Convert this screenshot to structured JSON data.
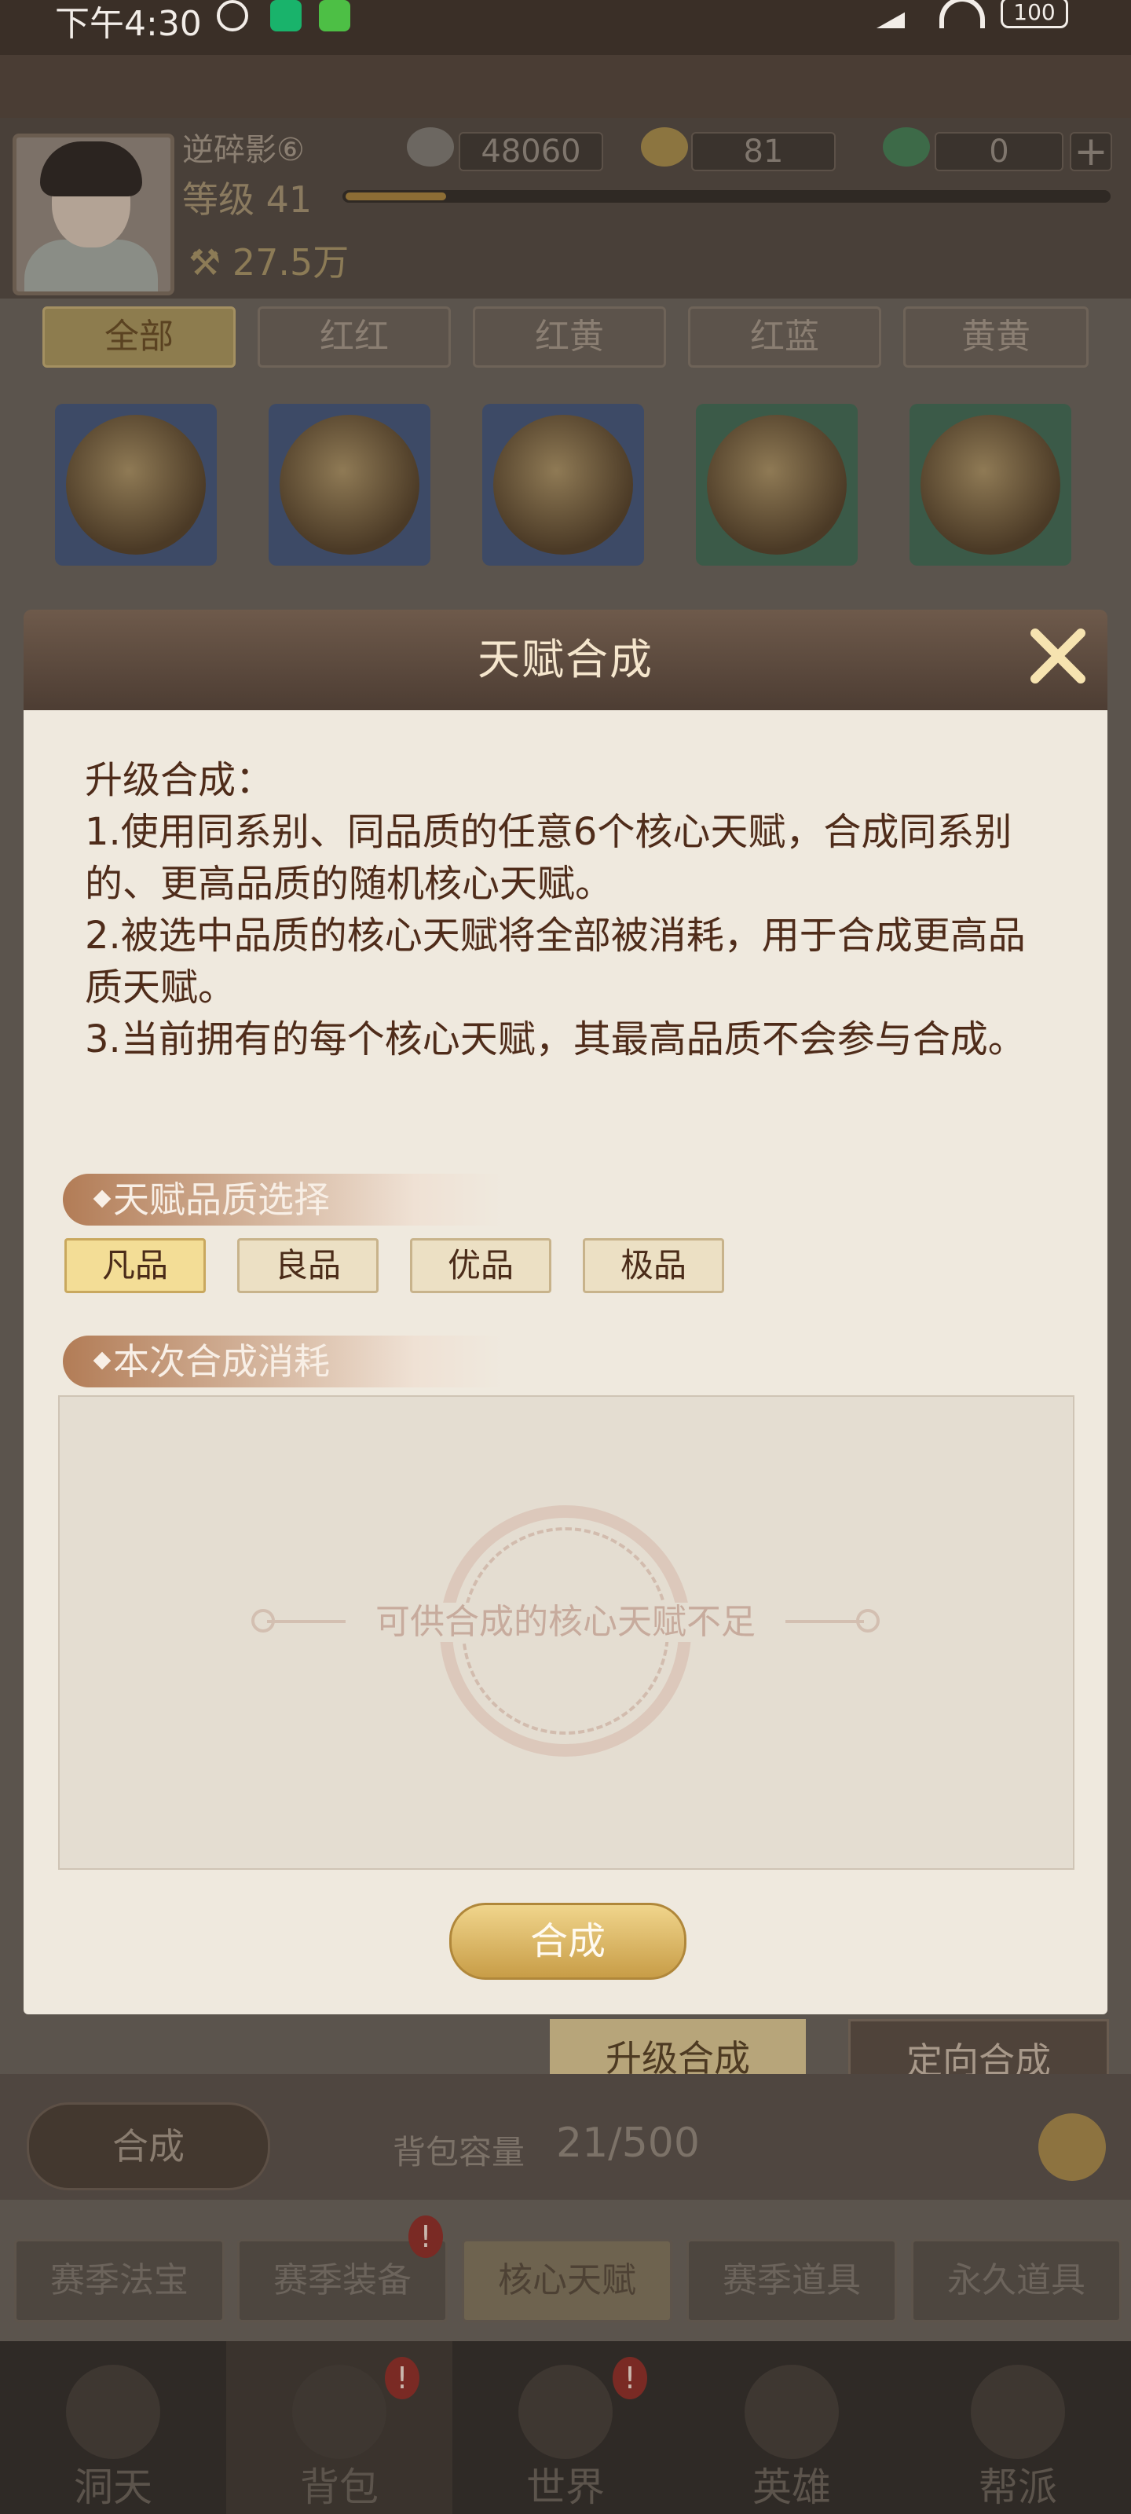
{
  "status_bar": {
    "time": "下午4:30",
    "battery": "100"
  },
  "player": {
    "name": "逆碎影⑥",
    "level": "等级 41",
    "power": "27.5万"
  },
  "currency": {
    "silver": "48060",
    "gold": "81",
    "jade": "0",
    "add_label": "+"
  },
  "filter_tabs": [
    "全部",
    "红红",
    "红黄",
    "红蓝",
    "黄黄"
  ],
  "dialog": {
    "title": "天赋合成",
    "description": "升级合成：\n1.使用同系别、同品质的任意6个核心天赋，合成同系别的、更高品质的随机核心天赋。\n2.被选中品质的核心天赋将全部被消耗，用于合成更高品质天赋。\n3.当前拥有的每个核心天赋，其最高品质不会参与合成。",
    "quality_section": "天赋品质选择",
    "quality_options": [
      "凡品",
      "良品",
      "优品",
      "极品"
    ],
    "cost_section": "本次合成消耗",
    "empty_text": "可供合成的核心天赋不足",
    "synth_button": "合成"
  },
  "mode_tabs": [
    "升级合成",
    "定向合成"
  ],
  "bag": {
    "synth_button": "合成",
    "capacity_label": "背包容量",
    "capacity_value": "21/500"
  },
  "categories": [
    "赛季法宝",
    "赛季装备",
    "核心天赋",
    "赛季道具",
    "永久道具"
  ],
  "nav": [
    "洞天",
    "背包",
    "世界",
    "英雄",
    "帮派"
  ],
  "colors": {
    "accent_gold": "#c89d47",
    "dialog_bg": "#efe9de",
    "text_brown": "#4f2c1a"
  }
}
